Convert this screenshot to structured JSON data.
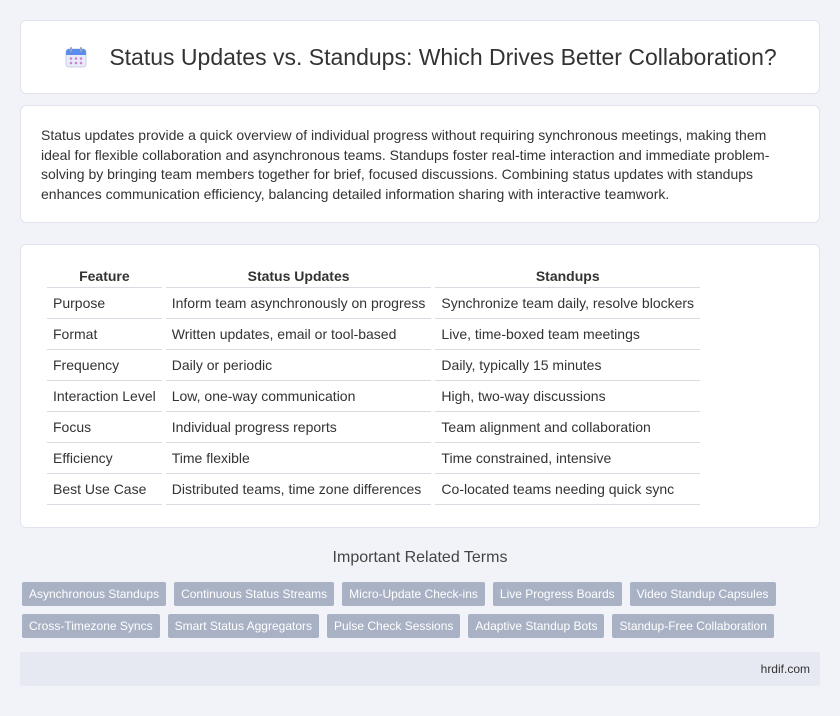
{
  "header": {
    "title": "Status Updates vs. Standups: Which Drives Better Collaboration?",
    "icon": "calendar-icon"
  },
  "intro": {
    "text": "Status updates provide a quick overview of individual progress without requiring synchronous meetings, making them ideal for flexible collaboration and asynchronous teams. Standups foster real-time interaction and immediate problem-solving by bringing team members together for brief, focused discussions. Combining status updates with standups enhances communication efficiency, balancing detailed information sharing with interactive teamwork."
  },
  "table": {
    "headers": [
      "Feature",
      "Status Updates",
      "Standups"
    ],
    "rows": [
      [
        "Purpose",
        "Inform team asynchronously on progress",
        "Synchronize team daily, resolve blockers"
      ],
      [
        "Format",
        "Written updates, email or tool-based",
        "Live, time-boxed team meetings"
      ],
      [
        "Frequency",
        "Daily or periodic",
        "Daily, typically 15 minutes"
      ],
      [
        "Interaction Level",
        "Low, one-way communication",
        "High, two-way discussions"
      ],
      [
        "Focus",
        "Individual progress reports",
        "Team alignment and collaboration"
      ],
      [
        "Efficiency",
        "Time flexible",
        "Time constrained, intensive"
      ],
      [
        "Best Use Case",
        "Distributed teams, time zone differences",
        "Co-located teams needing quick sync"
      ]
    ]
  },
  "terms": {
    "title": "Important Related Terms",
    "row1": [
      "Asynchronous Standups",
      "Continuous Status Streams",
      "Micro-Update Check-ins",
      "Live Progress Boards",
      "Video Standup Capsules"
    ],
    "row2": [
      "Cross-Timezone Syncs",
      "Smart Status Aggregators",
      "Pulse Check Sessions",
      "Adaptive Standup Bots",
      "Standup-Free Collaboration"
    ]
  },
  "footer": {
    "site": "hrdif.com"
  },
  "colors": {
    "tag_bg": "#a9b1c4",
    "page_bg": "#f1f3f8",
    "footer_bg": "#e6e9f2"
  }
}
